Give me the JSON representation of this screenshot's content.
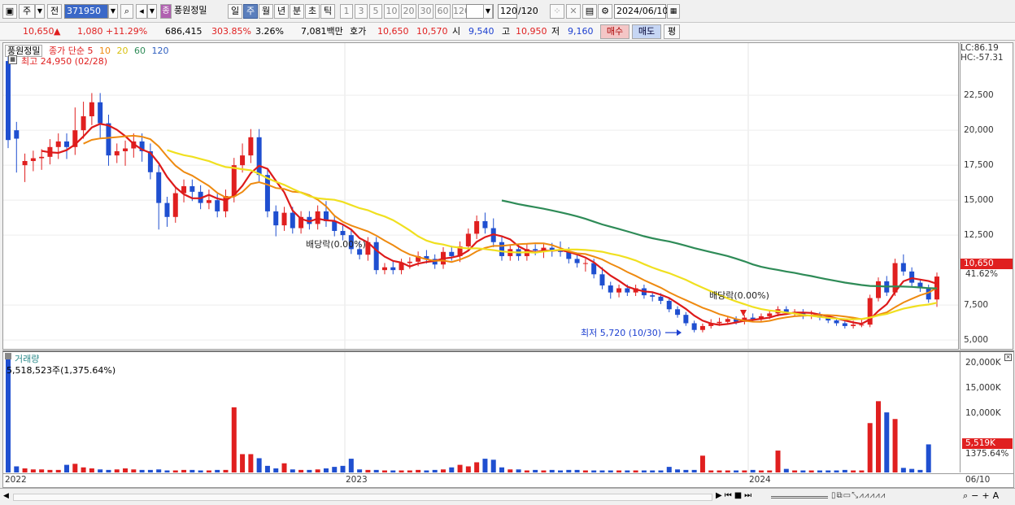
{
  "toolbar": {
    "market_btn": "주",
    "prev_btn": "전",
    "code": "371950",
    "stock_badge": "종",
    "stock_name": "풍원정밀",
    "periods": [
      "일",
      "주",
      "월",
      "년",
      "분",
      "초",
      "틱"
    ],
    "active_period": "주",
    "minute_options": [
      "1",
      "3",
      "5",
      "10",
      "20",
      "30",
      "60",
      "120"
    ],
    "count": "120",
    "count_max": "/120",
    "date": "2024/06/10"
  },
  "quote": {
    "price": "10,650",
    "change_arrow": "▲",
    "change": "1,080",
    "change_rate": "+11.29%",
    "volume": "686,415",
    "volume_ratio": "303.85%",
    "turnover": "3.26%",
    "amount": "7,081백만",
    "bid_label": "호가",
    "ask_price": "10,650",
    "bid_price": "10,570",
    "open_label": "시",
    "open": "9,540",
    "high_label": "고",
    "high": "10,950",
    "low_label": "저",
    "low": "9,160",
    "buy_btn": "매수",
    "sell_btn": "매도",
    "eval_btn": "평"
  },
  "price_panel": {
    "name_tag": "풍원정밀",
    "ma_label": "종가 단순",
    "ma_periods": [
      "5",
      "10",
      "20",
      "60",
      "120"
    ],
    "ma_colors": [
      "#dd1a1a",
      "#ee8a10",
      "#e8d020",
      "#2e8b57",
      "#3060c0"
    ],
    "high_note": "최고 24,950 (02/28)",
    "low_note": "최저 5,720 (10/30)",
    "div_note_1": "배당락(0.00%)",
    "div_note_2": "배당락(0.00%)",
    "lc": "LC:86.19",
    "hc": "HC:-57.31",
    "current_price_tag": "10,650",
    "current_pct_tag": "41.62%"
  },
  "volume_panel": {
    "title": "거래량",
    "max_note": "5,518,523주(1,375.64%)",
    "current_tag": "5,519K",
    "current_pct": "1375.64%"
  },
  "x_axis": {
    "labels": [
      "2022",
      "2023",
      "2024"
    ],
    "right_label": "06/10"
  },
  "chart_data": {
    "type": "candlestick",
    "price_ylim": [
      4600,
      26000
    ],
    "price_ticks": [
      "22,500",
      "20,000",
      "17,500",
      "15,000",
      "12,500",
      "10,650",
      "7,500",
      "5,000"
    ],
    "price_tick_values": [
      22500,
      20000,
      17500,
      15000,
      12500,
      10650,
      7500,
      5000
    ],
    "volume_ylim": [
      0,
      23000
    ],
    "volume_ticks": [
      "20,000K",
      "15,000K",
      "10,000K",
      "5,519K"
    ],
    "volume_tick_values": [
      20000,
      15000,
      10000,
      5519
    ],
    "weeks": 124,
    "candles": [
      [
        24950,
        20000,
        19300
      ],
      [
        20000,
        17500,
        19400
      ],
      [
        17500,
        16800,
        17800
      ],
      [
        17800,
        17600,
        18000
      ],
      [
        18000,
        17700,
        18100
      ],
      [
        18100,
        18200,
        18800
      ],
      [
        18800,
        18500,
        19200
      ],
      [
        19200,
        18500,
        18800
      ],
      [
        18800,
        21000,
        20000
      ],
      [
        20000,
        21400,
        21000
      ],
      [
        21000,
        21200,
        22000
      ],
      [
        22000,
        20000,
        20500
      ],
      [
        20500,
        18000,
        18200
      ],
      [
        18200,
        18300,
        18500
      ],
      [
        18500,
        18000,
        18700
      ],
      [
        18700,
        18600,
        19200
      ],
      [
        19200,
        18300,
        18500
      ],
      [
        18500,
        17500,
        17000
      ],
      [
        17000,
        13300,
        14800
      ],
      [
        14800,
        13500,
        13800
      ],
      [
        13800,
        14000,
        15500
      ],
      [
        15500,
        15300,
        16000
      ],
      [
        16000,
        15400,
        15600
      ],
      [
        15600,
        15200,
        14800
      ],
      [
        14800,
        15300,
        15000
      ],
      [
        15000,
        14700,
        14200
      ],
      [
        14200,
        15000,
        15300
      ],
      [
        15300,
        17000,
        17500
      ],
      [
        17500,
        18500,
        18200
      ],
      [
        18200,
        18500,
        19500
      ],
      [
        19500,
        17200,
        16800
      ],
      [
        16800,
        16000,
        14200
      ],
      [
        14200,
        12800,
        13200
      ],
      [
        13200,
        13800,
        14100
      ],
      [
        14100,
        13500,
        13000
      ],
      [
        13000,
        13600,
        13800
      ],
      [
        13800,
        13600,
        13300
      ],
      [
        13300,
        13800,
        14200
      ],
      [
        14200,
        14500,
        13500
      ],
      [
        13500,
        13300,
        12800
      ],
      [
        12800,
        12800,
        12500
      ],
      [
        12500,
        12000,
        11500
      ],
      [
        11500,
        11700,
        11100
      ],
      [
        11100,
        11000,
        12000
      ],
      [
        12000,
        11300,
        10000
      ],
      [
        10000,
        10100,
        10200
      ],
      [
        10200,
        10300,
        10000
      ],
      [
        10000,
        10200,
        10500
      ],
      [
        10500,
        10400,
        10600
      ],
      [
        10600,
        10600,
        11000
      ],
      [
        11000,
        11100,
        10800
      ],
      [
        10800,
        10600,
        10400
      ],
      [
        10400,
        10800,
        11300
      ],
      [
        11300,
        11400,
        11000
      ],
      [
        11000,
        10900,
        11700
      ],
      [
        11700,
        12100,
        12600
      ],
      [
        12600,
        13000,
        13500
      ],
      [
        13500,
        13700,
        13000
      ],
      [
        13000,
        13300,
        12000
      ],
      [
        12000,
        11100,
        11000
      ],
      [
        11000,
        11000,
        11500
      ],
      [
        11500,
        11200,
        11000
      ],
      [
        11000,
        11300,
        11500
      ],
      [
        11500,
        11400,
        11400
      ],
      [
        11400,
        11200,
        11600
      ],
      [
        11600,
        11300,
        11400
      ],
      [
        11400,
        11700,
        11300
      ],
      [
        11300,
        11100,
        10800
      ],
      [
        10800,
        10900,
        10500
      ],
      [
        10500,
        10200,
        10500
      ],
      [
        10500,
        10100,
        9700
      ],
      [
        9700,
        9900,
        8900
      ],
      [
        8900,
        8200,
        8400
      ],
      [
        8400,
        8300,
        8700
      ],
      [
        8700,
        8600,
        8400
      ],
      [
        8400,
        8600,
        8700
      ],
      [
        8700,
        8300,
        8200
      ],
      [
        8200,
        8000,
        8100
      ],
      [
        8100,
        8000,
        7800
      ],
      [
        7800,
        7500,
        7200
      ],
      [
        7200,
        7000,
        6800
      ],
      [
        6800,
        6700,
        6200
      ],
      [
        6200,
        6100,
        5720
      ],
      [
        5720,
        5950,
        6000
      ],
      [
        6000,
        6300,
        6200
      ],
      [
        6200,
        6400,
        6300
      ],
      [
        6300,
        6400,
        6500
      ],
      [
        6500,
        6400,
        6300
      ],
      [
        6300,
        6500,
        6600
      ],
      [
        6600,
        6700,
        6500
      ],
      [
        6500,
        6600,
        6700
      ],
      [
        6700,
        6800,
        6900
      ],
      [
        6900,
        7000,
        7200
      ],
      [
        7200,
        7100,
        7000
      ],
      [
        7000,
        6900,
        7000
      ],
      [
        7000,
        6800,
        6700
      ],
      [
        6700,
        6900,
        6800
      ],
      [
        6800,
        6700,
        6600
      ],
      [
        6600,
        6500,
        6400
      ],
      [
        6400,
        6300,
        6200
      ],
      [
        6200,
        6100,
        6000
      ],
      [
        6000,
        6200,
        6100
      ],
      [
        6100,
        6300,
        6100
      ],
      [
        6100,
        7000,
        8000
      ],
      [
        8000,
        8600,
        9200
      ],
      [
        9200,
        9300,
        8400
      ],
      [
        8400,
        9800,
        10500
      ],
      [
        10500,
        10800,
        9900
      ],
      [
        9900,
        9200,
        9100
      ],
      [
        9100,
        9000,
        8700
      ],
      [
        8700,
        8300,
        7900
      ],
      [
        7900,
        7600,
        9540
      ]
    ],
    "high_low_extra": {
      "hi_last": 10950,
      "lo_last": 9160
    },
    "volumes": [
      23000,
      1200,
      800,
      600,
      600,
      500,
      500,
      1500,
      1700,
      1000,
      800,
      600,
      500,
      600,
      800,
      600,
      500,
      500,
      600,
      400,
      400,
      500,
      500,
      400,
      400,
      500,
      500,
      12800,
      3600,
      3600,
      2800,
      1300,
      800,
      1800,
      600,
      500,
      500,
      600,
      800,
      1100,
      1300,
      2700,
      600,
      500,
      500,
      400,
      400,
      400,
      400,
      500,
      400,
      500,
      600,
      1000,
      1500,
      1200,
      2000,
      2700,
      2500,
      1000,
      600,
      600,
      400,
      500,
      400,
      500,
      400,
      500,
      500,
      400,
      400,
      400,
      400,
      400,
      400,
      400,
      400,
      400,
      400,
      1100,
      600,
      500,
      500,
      3300,
      400,
      400,
      400,
      400,
      400,
      500,
      400,
      400,
      4300,
      700,
      400,
      400,
      400,
      400,
      400,
      400,
      500,
      400,
      400,
      9700,
      14000,
      11800,
      10500,
      900,
      700,
      500,
      5519
    ],
    "ma5_start": 4,
    "ma20_start": 19,
    "ma60_start": 59,
    "dates_hint": [
      "2022",
      "2023",
      "2024",
      "06/10"
    ]
  }
}
